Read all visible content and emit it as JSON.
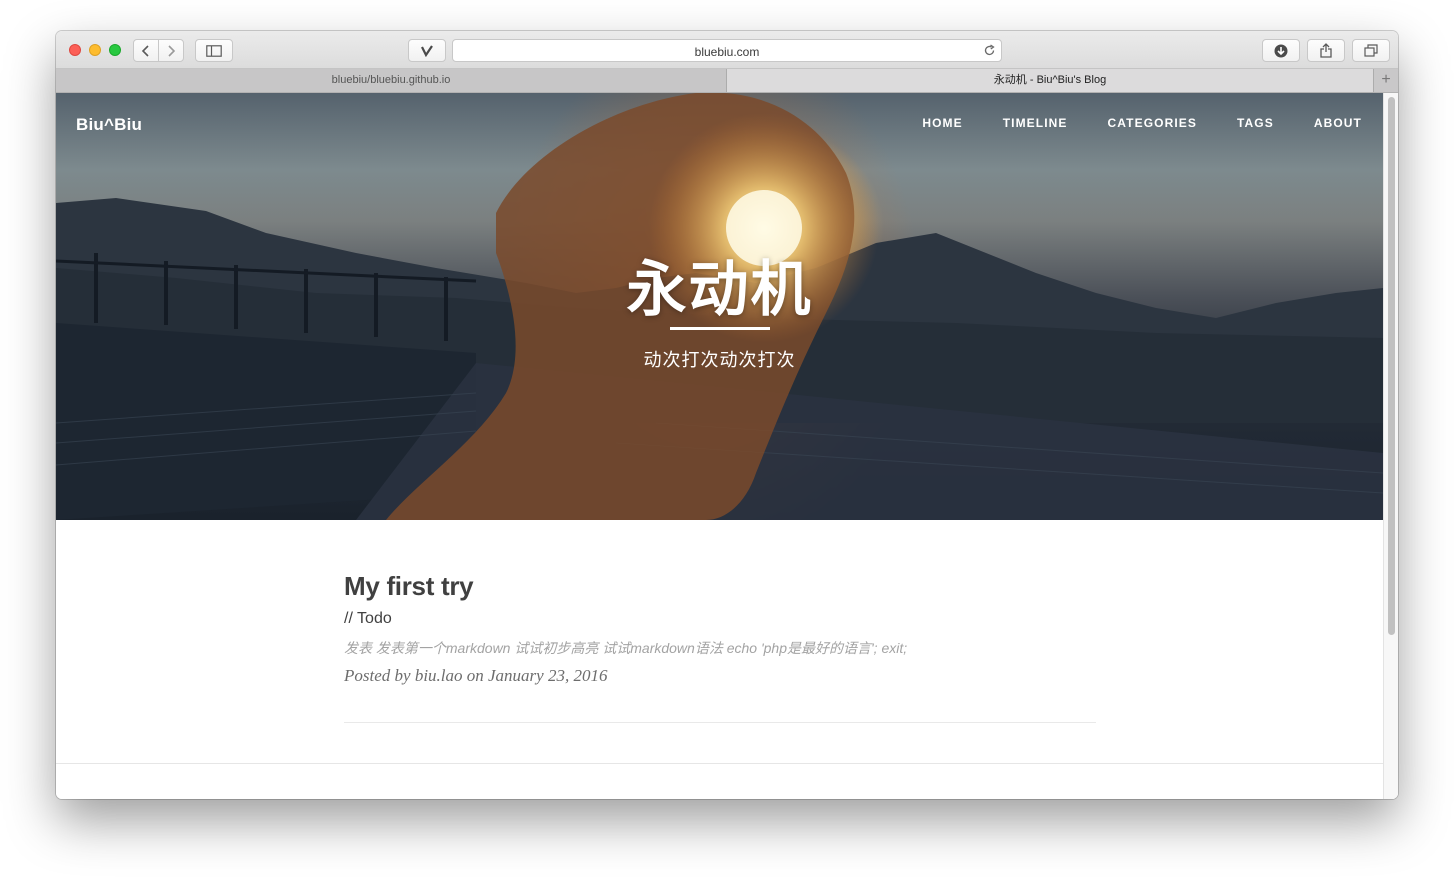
{
  "browser": {
    "address": "bluebiu.com",
    "tabs": [
      {
        "label": "bluebiu/bluebiu.github.io",
        "active": false
      },
      {
        "label": "永动机 - Biu^Biu's Blog",
        "active": true
      }
    ],
    "new_tab_label": "+"
  },
  "site": {
    "brand": "Biu^Biu",
    "nav": [
      "HOME",
      "TIMELINE",
      "CATEGORIES",
      "TAGS",
      "ABOUT"
    ]
  },
  "hero": {
    "title": "永动机",
    "subtitle": "动次打次动次打次"
  },
  "post": {
    "title": "My first try",
    "subtitle": "// Todo",
    "excerpt": "发表 发表第一个markdown 试试初步高亮 试试markdown语法 echo 'php是最好的语言'; exit;",
    "meta": "Posted by biu.lao on January 23, 2016"
  }
}
